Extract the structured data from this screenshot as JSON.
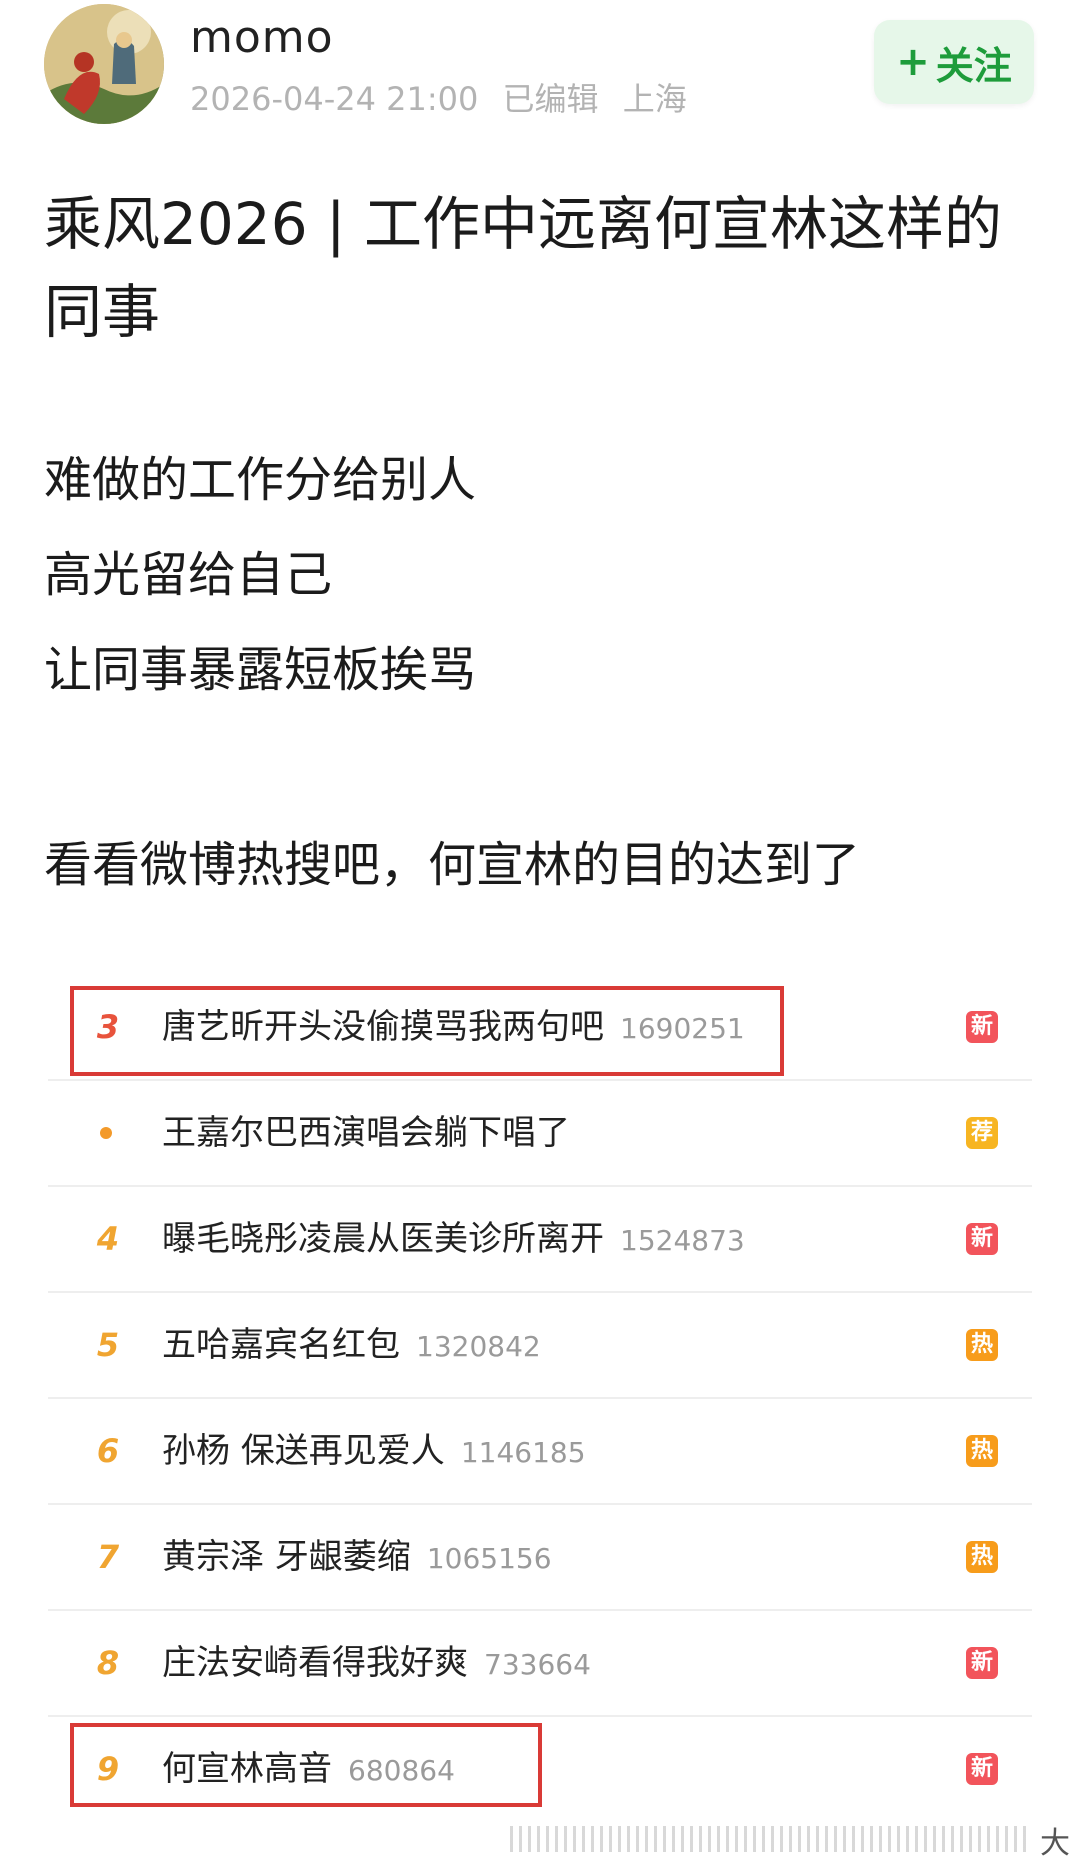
{
  "post": {
    "username": "momo",
    "time": "2026-04-24 21:00",
    "edited": "已编辑",
    "location": "上海",
    "follow_label": "关注",
    "title": "乘风2026 | 工作中远离何宣林这样的同事",
    "lines": [
      "难做的工作分给别人",
      "高光留给自己",
      "让同事暴露短板挨骂"
    ],
    "comment": "看看微博热搜吧，何宣林的目的达到了"
  },
  "hot_search": [
    {
      "rank": "3",
      "topic": "唐艺昕开头没偷摸骂我两句吧",
      "count": "1690251",
      "badge": "新",
      "badge_color": "#f2545b",
      "highlighted": true
    },
    {
      "rank": "•",
      "topic": "王嘉尔巴西演唱会躺下唱了",
      "count": "",
      "badge": "荐",
      "badge_color": "#f7b522",
      "highlighted": false
    },
    {
      "rank": "4",
      "topic": "曝毛晓彤凌晨从医美诊所离开",
      "count": "1524873",
      "badge": "新",
      "badge_color": "#f2545b",
      "highlighted": false
    },
    {
      "rank": "5",
      "topic": "五哈嘉宾名红包",
      "count": "1320842",
      "badge": "热",
      "badge_color": "#f79c1b",
      "highlighted": false
    },
    {
      "rank": "6",
      "topic": "孙杨 保送再见爱人",
      "count": "1146185",
      "badge": "热",
      "badge_color": "#f79c1b",
      "highlighted": false
    },
    {
      "rank": "7",
      "topic": "黄宗泽 牙龈萎缩",
      "count": "1065156",
      "badge": "热",
      "badge_color": "#f79c1b",
      "highlighted": false
    },
    {
      "rank": "8",
      "topic": "庄法安崎看得我好爽",
      "count": "733664",
      "badge": "新",
      "badge_color": "#f2545b",
      "highlighted": false
    },
    {
      "rank": "9",
      "topic": "何宣林高音",
      "count": "680864",
      "badge": "新",
      "badge_color": "#f2545b",
      "highlighted": true
    }
  ],
  "colors": {
    "follow_bg": "#e6f7e9",
    "follow_text": "#1e9c3b",
    "highlight_border": "#d93a36"
  },
  "footer_glyph": "大"
}
